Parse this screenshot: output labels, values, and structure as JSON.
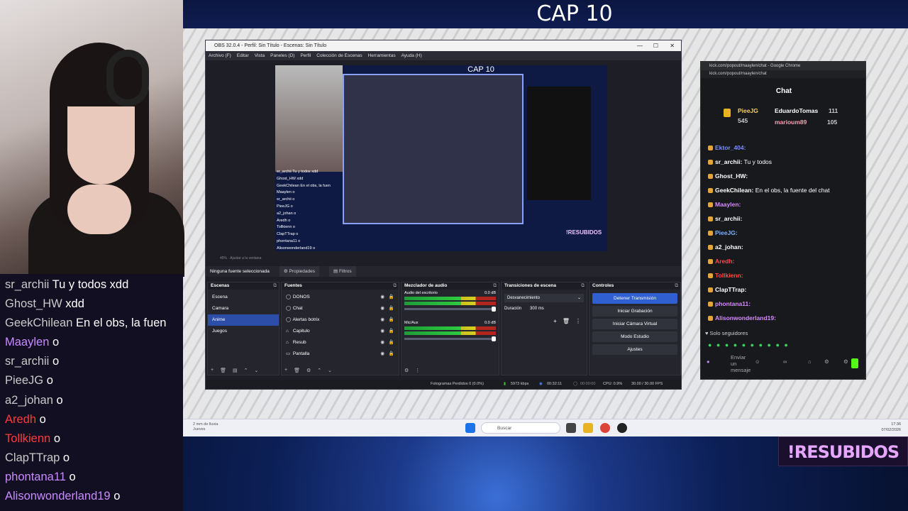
{
  "stream": {
    "title": "CAP 10",
    "resubidos": "!RESUBIDOS"
  },
  "left_chat": [
    {
      "name": "sr_archii",
      "text": "Tu y todos xdd",
      "color": "#c9c9c9"
    },
    {
      "name": "Ghost_HW",
      "text": "xdd",
      "color": "#c9c9c9"
    },
    {
      "name": "GeekChilean",
      "text": "En el obs, la fuen",
      "color": "#c9c9c9"
    },
    {
      "name": "Maaylen",
      "text": "o",
      "color": "#c88bff"
    },
    {
      "name": "sr_archii",
      "text": "o",
      "color": "#c9c9c9"
    },
    {
      "name": "PieeJG",
      "text": "o",
      "color": "#c9c9c9"
    },
    {
      "name": "a2_johan",
      "text": "o",
      "color": "#c9c9c9"
    },
    {
      "name": "Aredh",
      "text": "o",
      "color": "#ff3b3b"
    },
    {
      "name": "Tollkienn",
      "text": "o",
      "color": "#ff3b3b"
    },
    {
      "name": "ClapTTrap",
      "text": "o",
      "color": "#c9c9c9"
    },
    {
      "name": "phontana11",
      "text": "o",
      "color": "#c88bff"
    },
    {
      "name": "Alisonwonderland19",
      "text": "o",
      "color": "#c88bff"
    }
  ],
  "obs": {
    "window_title": "OBS 32.0.4 - Perfil: Sin Título - Escenas: Sin Título",
    "menu": [
      "Archivo (F)",
      "Editar",
      "Vista",
      "Paneles (D)",
      "Perfil",
      "Colección de Escenas",
      "Herramientas",
      "Ayuda (H)"
    ],
    "preview_lines": [
      "sr_archii Tu y todos xdd",
      "Ghost_HW xdd",
      "GeekChilean En el obs, la fuen",
      "Maaylen o",
      "sr_archii o",
      "PieeJG o",
      "a2_johan o",
      "Aredh o",
      "Tollkienn o",
      "ClapTTrap o",
      "phontana11 o",
      "Alisonwonderland19 o"
    ],
    "zoom_label": "45%  ·  Ajustar a la ventana",
    "source_status": "Ninguna fuente seleccionada",
    "properties_label": "Propiedades",
    "filters_label": "Filtros",
    "scenes_header": "Escenas",
    "scenes": [
      "Escena",
      "Camara",
      "Anime",
      "Juegos"
    ],
    "sources_header": "Fuentes",
    "sources": [
      {
        "name": "DONOS",
        "icon": "◯"
      },
      {
        "name": "Chat",
        "icon": "◯"
      },
      {
        "name": "Alertas botrix",
        "icon": "◯"
      },
      {
        "name": "Capitulo",
        "icon": "⌂"
      },
      {
        "name": "Resub",
        "icon": "⌂"
      },
      {
        "name": "Pantalla",
        "icon": "▭"
      }
    ],
    "mixer_header": "Mezclador de audio",
    "mixer": [
      {
        "name": "Audio del escritorio",
        "db": "0.0 dB"
      },
      {
        "name": "Mic/Aux",
        "db": "0.0 dB"
      }
    ],
    "transitions_header": "Transiciones de escena",
    "transition_value": "Desvanecimiento",
    "duration_label": "Duración",
    "duration_value": "300 ms",
    "controls_header": "Controles",
    "controls": [
      "Detener Transmisión",
      "Iniciar Grabación",
      "Iniciar Cámara Virtual",
      "Modo Estudio",
      "Ajustes"
    ],
    "status": {
      "dropped": "Fotogramas Perdidos 0 (0.0%)",
      "bitrate": "5973 kbps",
      "live_time": "00:32:11",
      "rec_time": "00:00:00",
      "cpu": "CPU: 0.9%",
      "fps": "30.00 / 30.00 FPS"
    }
  },
  "chrome": {
    "tab_title": "kick.com/popout/maaylen/chat - Google Chrome",
    "url": "kick.com/popout/maaylen/chat",
    "chat_title": "Chat",
    "top_supporters": [
      {
        "name": "PieeJG",
        "value": "545"
      },
      {
        "name": "EduardoTomas",
        "value": "111"
      },
      {
        "name": "marioum89",
        "value": "105"
      }
    ],
    "messages": [
      {
        "name": "Ektor_404:",
        "text": "",
        "color": "#7b8cff"
      },
      {
        "name": "sr_archii:",
        "text": "Tu y todos",
        "color": "#ffffff"
      },
      {
        "name": "Ghost_HW:",
        "text": "",
        "color": "#ffffff"
      },
      {
        "name": "GeekChilean:",
        "text": "En el obs, la fuente del chat",
        "color": "#ffffff"
      },
      {
        "name": "Maaylen:",
        "text": "",
        "color": "#d58bff"
      },
      {
        "name": "sr_archii:",
        "text": "",
        "color": "#ffffff"
      },
      {
        "name": "PieeJG:",
        "text": "",
        "color": "#7bb0ff"
      },
      {
        "name": "a2_johan:",
        "text": "",
        "color": "#ffffff"
      },
      {
        "name": "Aredh:",
        "text": "",
        "color": "#ff4a4a"
      },
      {
        "name": "Tollkienn:",
        "text": "",
        "color": "#ff4a4a"
      },
      {
        "name": "ClapTTrap:",
        "text": "",
        "color": "#ffffff"
      },
      {
        "name": "phontana11:",
        "text": "",
        "color": "#d58bff"
      },
      {
        "name": "Alisonwonderland19:",
        "text": "",
        "color": "#d58bff"
      }
    ],
    "followers_only": "Solo seguidores",
    "input_placeholder": "Enviar un mensaje"
  },
  "taskbar": {
    "weather_line1": "2 mm de lluvia",
    "weather_line2": "Jueves",
    "search_placeholder": "Buscar",
    "time": "17:36",
    "date": "07/02/2026"
  }
}
